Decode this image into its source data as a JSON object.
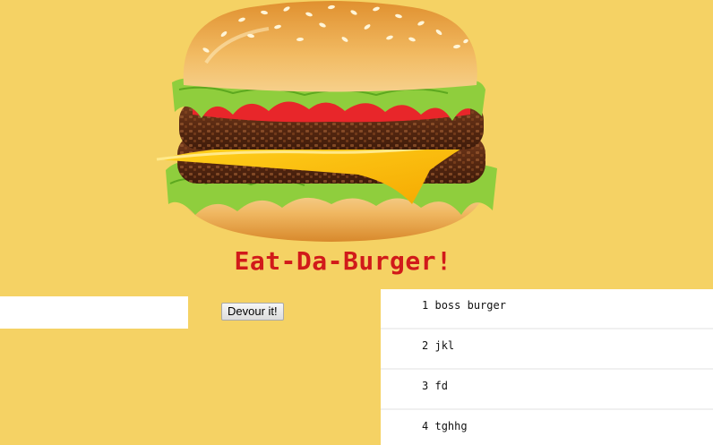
{
  "header": {
    "title": "Eat-Da-Burger!",
    "image_icon": "hamburger-illustration"
  },
  "form": {
    "input_value": "",
    "input_placeholder": "",
    "button_label": "Devour it!"
  },
  "burgers": [
    {
      "id": "1",
      "name": "boss burger"
    },
    {
      "id": "2",
      "name": "jkl"
    },
    {
      "id": "3",
      "name": "fd"
    },
    {
      "id": "4",
      "name": "tghhg"
    }
  ],
  "colors": {
    "background": "#f5d264",
    "title": "#d11a1a",
    "list_bg": "#ffffff"
  }
}
